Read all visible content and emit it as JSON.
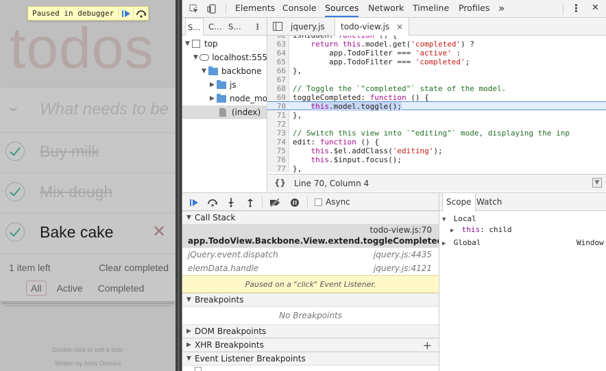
{
  "app": {
    "logo": "todos",
    "new_todo_placeholder": "What needs to be",
    "todos": [
      {
        "title": "Buy milk",
        "completed": true
      },
      {
        "title": "Mix dough",
        "completed": true
      },
      {
        "title": "Bake cake",
        "completed": false
      }
    ],
    "items_left": "1 item left",
    "clear_completed": "Clear completed",
    "filters": [
      "All",
      "Active",
      "Completed"
    ],
    "info_edit": "Double-click to edit a todo",
    "info_author": "Written by Addy Osmani",
    "paused_banner": "Paused in debugger"
  },
  "devtools": {
    "tabs": [
      "Elements",
      "Console",
      "Sources",
      "Network",
      "Timeline",
      "Profiles"
    ],
    "active_tab": "Sources",
    "more_tabs": "»",
    "menu": "⋮",
    "close": "✕",
    "navigator": {
      "tabs": [
        "S…",
        "C…",
        "S…"
      ],
      "tree": [
        {
          "label": "top",
          "depth": 0,
          "icon": "frame",
          "expanded": true
        },
        {
          "label": "localhost:555",
          "depth": 1,
          "icon": "cloud",
          "expanded": true
        },
        {
          "label": "backbone",
          "depth": 2,
          "icon": "folder",
          "expanded": true
        },
        {
          "label": "js",
          "depth": 3,
          "icon": "folder",
          "expanded": false
        },
        {
          "label": "node_mo",
          "depth": 3,
          "icon": "folder",
          "expanded": false
        },
        {
          "label": "(index)",
          "depth": 3,
          "icon": "file",
          "expanded": null,
          "selected": true
        }
      ]
    },
    "editor_tabs": [
      {
        "label": "jquery.js",
        "active": false
      },
      {
        "label": "todo-view.js",
        "active": true,
        "close": "×"
      }
    ],
    "code": {
      "highlighted_line": 70,
      "lines": [
        {
          "n": "62",
          "text": "    isHidden: function () {"
        },
        {
          "n": "63",
          "text": "        return this.model.get('completed') ?"
        },
        {
          "n": "64",
          "text": "            app.TodoFilter === 'active' :"
        },
        {
          "n": "65",
          "text": "            app.TodoFilter === 'completed';"
        },
        {
          "n": "66",
          "text": "    },"
        },
        {
          "n": "67",
          "text": ""
        },
        {
          "n": "68",
          "text": "    // Toggle the `\"completed\"` state of the model."
        },
        {
          "n": "69",
          "text": "    toggleCompleted: function () {"
        },
        {
          "n": "70",
          "text": "        this.model.toggle();"
        },
        {
          "n": "71",
          "text": "    },"
        },
        {
          "n": "72",
          "text": ""
        },
        {
          "n": "73",
          "text": "    // Switch this view into `\"editing\"` mode, displaying the inp"
        },
        {
          "n": "74",
          "text": "    edit: function () {"
        },
        {
          "n": "75",
          "text": "        this.$el.addClass('editing');"
        },
        {
          "n": "76",
          "text": "        this.$input.focus();"
        },
        {
          "n": "77",
          "text": "    },"
        }
      ]
    },
    "status": {
      "braces": "{}",
      "position": "Line 70, Column 4"
    },
    "debugger": {
      "async_label": "Async",
      "async_checked": false,
      "call_stack_title": "Call Stack",
      "frames": [
        {
          "fn": "app.TodoView.Backbone.View.extend.toggleCompleted",
          "loc": "todo-view.js:70",
          "selected": true
        },
        {
          "fn": "jQuery.event.dispatch",
          "loc": "jquery.js:4435",
          "selected": false
        },
        {
          "fn": "elemData.handle",
          "loc": "jquery.js:4121",
          "selected": false
        }
      ],
      "paused_reason": "Paused on a \"click\" Event Listener.",
      "breakpoints_title": "Breakpoints",
      "no_breakpoints": "No Breakpoints",
      "dom_breakpoints": "DOM Breakpoints",
      "xhr_breakpoints": "XHR Breakpoints",
      "xhr_add": "+",
      "event_listener_breakpoints": "Event Listener Breakpoints"
    },
    "scope": {
      "tabs": [
        "Scope",
        "Watch"
      ],
      "active_tab": "Scope",
      "local_label": "Local",
      "this_key": "this",
      "this_value": ": child",
      "global_label": "Global",
      "global_value": "Window"
    },
    "accent_color": "#3879d9"
  }
}
